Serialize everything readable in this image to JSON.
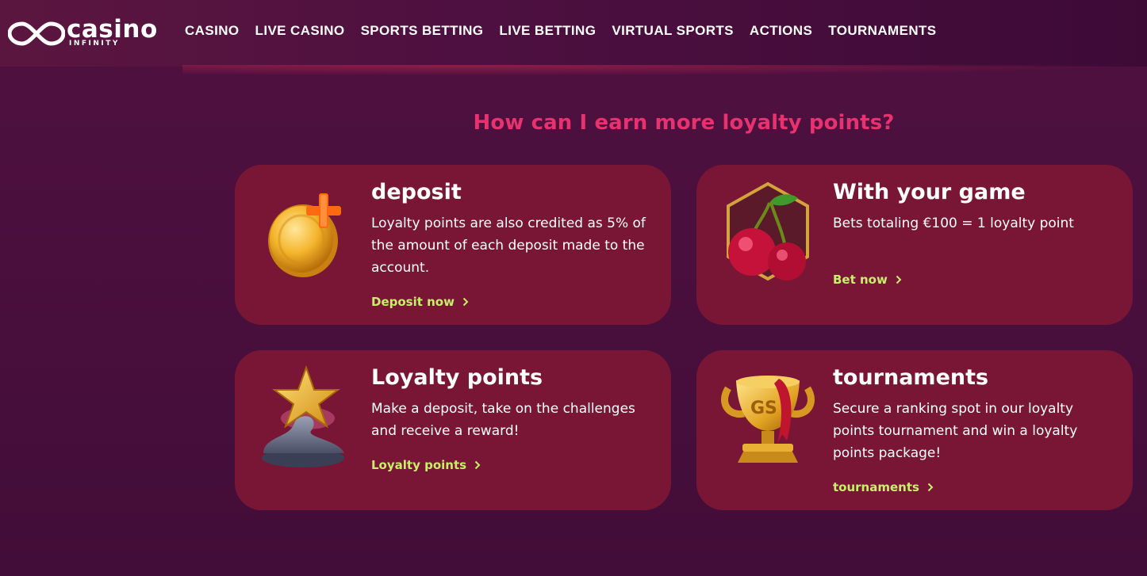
{
  "logo": {
    "word": "casino",
    "sub": "INFINITY"
  },
  "nav": [
    "CASINO",
    "LIVE CASINO",
    "SPORTS BETTING",
    "LIVE BETTING",
    "VIRTUAL SPORTS",
    "ACTIONS",
    "TOURNAMENTS"
  ],
  "section_title": "How can I earn more loyalty points?",
  "cards": [
    {
      "title": "deposit",
      "text": "Loyalty points are also credited as 5% of the amount of each deposit made to the account.",
      "link": "Deposit now",
      "icon": "gold-coin-plus-icon"
    },
    {
      "title": "With your game",
      "text": "Bets totaling €100 = 1 loyalty point",
      "link": "Bet now",
      "icon": "cherries-icon"
    },
    {
      "title": "Loyalty points",
      "text": "Make a deposit, take on the challenges and receive a reward!",
      "link": "Loyalty points",
      "icon": "star-trophy-icon"
    },
    {
      "title": "tournaments",
      "text": "Secure a ranking spot in our loyalty points tournament and win a loyalty points package!",
      "link": "tournaments",
      "icon": "gold-cup-icon"
    }
  ],
  "colors": {
    "accent_pink": "#e8316f",
    "link_green": "#c8ef6a",
    "card_bg": "#791636",
    "page_bg": "#4a0f3d"
  }
}
